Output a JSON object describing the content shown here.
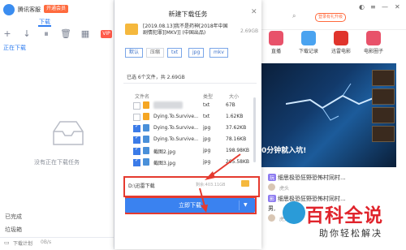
{
  "app": {
    "title": "腾讯客服",
    "badge": "开通会员",
    "active_tab": "下载",
    "downloading_label": "正在下载",
    "empty_text": "没有正在下载任务",
    "completed_label": "已完成",
    "trash_label": "垃圾箱",
    "plan_label": "下载计划",
    "speed_label": "0B/s",
    "vip_label": "VIP"
  },
  "right_panel": {
    "notice": "登录有礼升级",
    "nav": [
      {
        "label": "直播",
        "color": "#e8526a"
      },
      {
        "label": "下载记录",
        "color": "#4aa3f0"
      },
      {
        "label": "迅雷电影",
        "color": "#e0342c"
      },
      {
        "label": "电影圈子",
        "color": "#e8526a"
      }
    ],
    "media_caption": "0分钟就入坑!",
    "news": [
      {
        "tag": "玩",
        "text": "细思极恐狂野恐怖村同村..."
      },
      {
        "tag": "影",
        "text": "细思极恐狂野恐怖村同村..."
      }
    ],
    "news_author": "虎头",
    "news_text_2": "男,",
    "watermark": "百科全说",
    "watermark_sub": "助你轻松解决"
  },
  "dialog": {
    "title": "新建下载任务",
    "close": "✕",
    "task_name": "[2019.08.13]我不是药神[2018年中国剧情犯罪][MKV]] (中国出品)",
    "task_size": "2.69GB",
    "filters": [
      "默认",
      "压缩",
      "txt",
      "jpg",
      "mkv"
    ],
    "summary": "已选 6个文件，共 2.69GB",
    "headers": {
      "name": "文件名",
      "type": "类型",
      "size": "大小"
    },
    "files": [
      {
        "name": "",
        "type": "txt",
        "size": "67B",
        "checked": false,
        "icon": "#f5a623",
        "blurred": true
      },
      {
        "name": "Dying.To.Survive....",
        "type": "txt",
        "size": "1.62KB",
        "checked": false,
        "icon": "#f5a623",
        "blurred": false
      },
      {
        "name": "Dying.To.Survive....",
        "type": "jpg",
        "size": "37.62KB",
        "checked": true,
        "icon": "#4a90d9",
        "blurred": false
      },
      {
        "name": "Dying.To.Survive....",
        "type": "jpg",
        "size": "78.16KB",
        "checked": true,
        "icon": "#4a90d9",
        "blurred": false
      },
      {
        "name": "截图2.jpg",
        "type": "jpg",
        "size": "198.98KB",
        "checked": true,
        "icon": "#4a90d9",
        "blurred": false
      },
      {
        "name": "截图3.jpg",
        "type": "jpg",
        "size": "205.58KB",
        "checked": true,
        "icon": "#4a90d9",
        "blurred": false
      }
    ],
    "path": "D:\\迅雷下载",
    "path_free": "剩余:403.11GB",
    "download_label": "立即下载",
    "download_arrow": "▼"
  }
}
